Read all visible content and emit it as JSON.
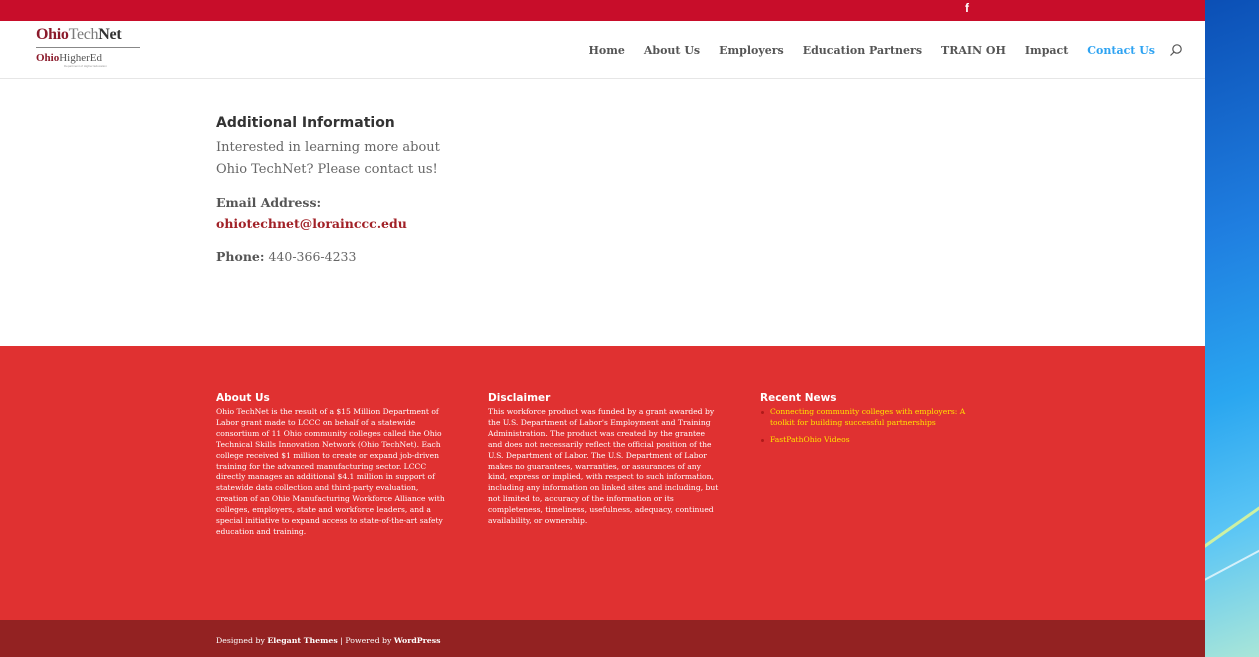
{
  "topbar": {
    "social_icon": "f"
  },
  "logo": {
    "line1_prefix": "Ohio",
    "line1_accent": "Tech",
    "line1_suffix": "Net",
    "line2_prefix": "Ohio",
    "line2_suffix": "HigherEd",
    "tagline": "Department of Higher Education"
  },
  "nav": {
    "items": [
      {
        "label": "Home"
      },
      {
        "label": "About Us"
      },
      {
        "label": "Employers"
      },
      {
        "label": "Education Partners"
      },
      {
        "label": "TRAIN OH"
      },
      {
        "label": "Impact"
      },
      {
        "label": "Contact Us",
        "active": true
      }
    ],
    "search_icon": "search-icon"
  },
  "contact": {
    "heading": "Additional Information",
    "intro": "Interested in learning more about Ohio TechNet? Please contact us!",
    "email_label": "Email Address:",
    "email": "ohiotechnet@lorainccc.edu",
    "phone_label": "Phone:",
    "phone": "440-366-4233"
  },
  "footer": {
    "about": {
      "heading": "About Us",
      "text": "Ohio TechNet is the result of a $15 Million Department of Labor grant made to LCCC on behalf of a statewide consortium of 11 Ohio community colleges called the Ohio Technical Skills Innovation Network (Ohio TechNet). Each college received $1 million to create or expand job-driven training for the advanced manufacturing sector. LCCC directly manages an additional $4.1 million in support of statewide data collection and third-party evaluation, creation of an Ohio Manufacturing Workforce Alliance with colleges, employers, state and workforce leaders, and a special initiative to expand access to state-of-the-art safety education and training."
    },
    "disclaimer": {
      "heading": "Disclaimer",
      "text": "This workforce product was funded by a grant awarded by the U.S. Department of Labor's Employment and Training Administration. The product was created by the grantee and does not necessarily reflect the official position of the U.S. Department of Labor. The U.S. Department of Labor makes no guarantees, warranties, or assurances of any kind, express or implied, with respect to such information, including any information on linked sites and including, but not limited to, accuracy of the information or its completeness, timeliness, usefulness, adequacy, continued availability, or ownership."
    },
    "news": {
      "heading": "Recent News",
      "items": [
        {
          "label": "Connecting community colleges with employers: A toolkit for building successful partnerships"
        },
        {
          "label": "FastPathOhio Videos"
        }
      ]
    }
  },
  "bottombar": {
    "designed_by": "Designed by",
    "theme_link": "Elegant Themes",
    "separator": " | Powered by ",
    "wp_link": "WordPress"
  },
  "colors": {
    "topbar": "#c80d2a",
    "footer": "#e03131",
    "bottombar": "#932222",
    "accent_link": "#2ea3f2",
    "email_link": "#a12127",
    "news_link": "#ffe400"
  }
}
